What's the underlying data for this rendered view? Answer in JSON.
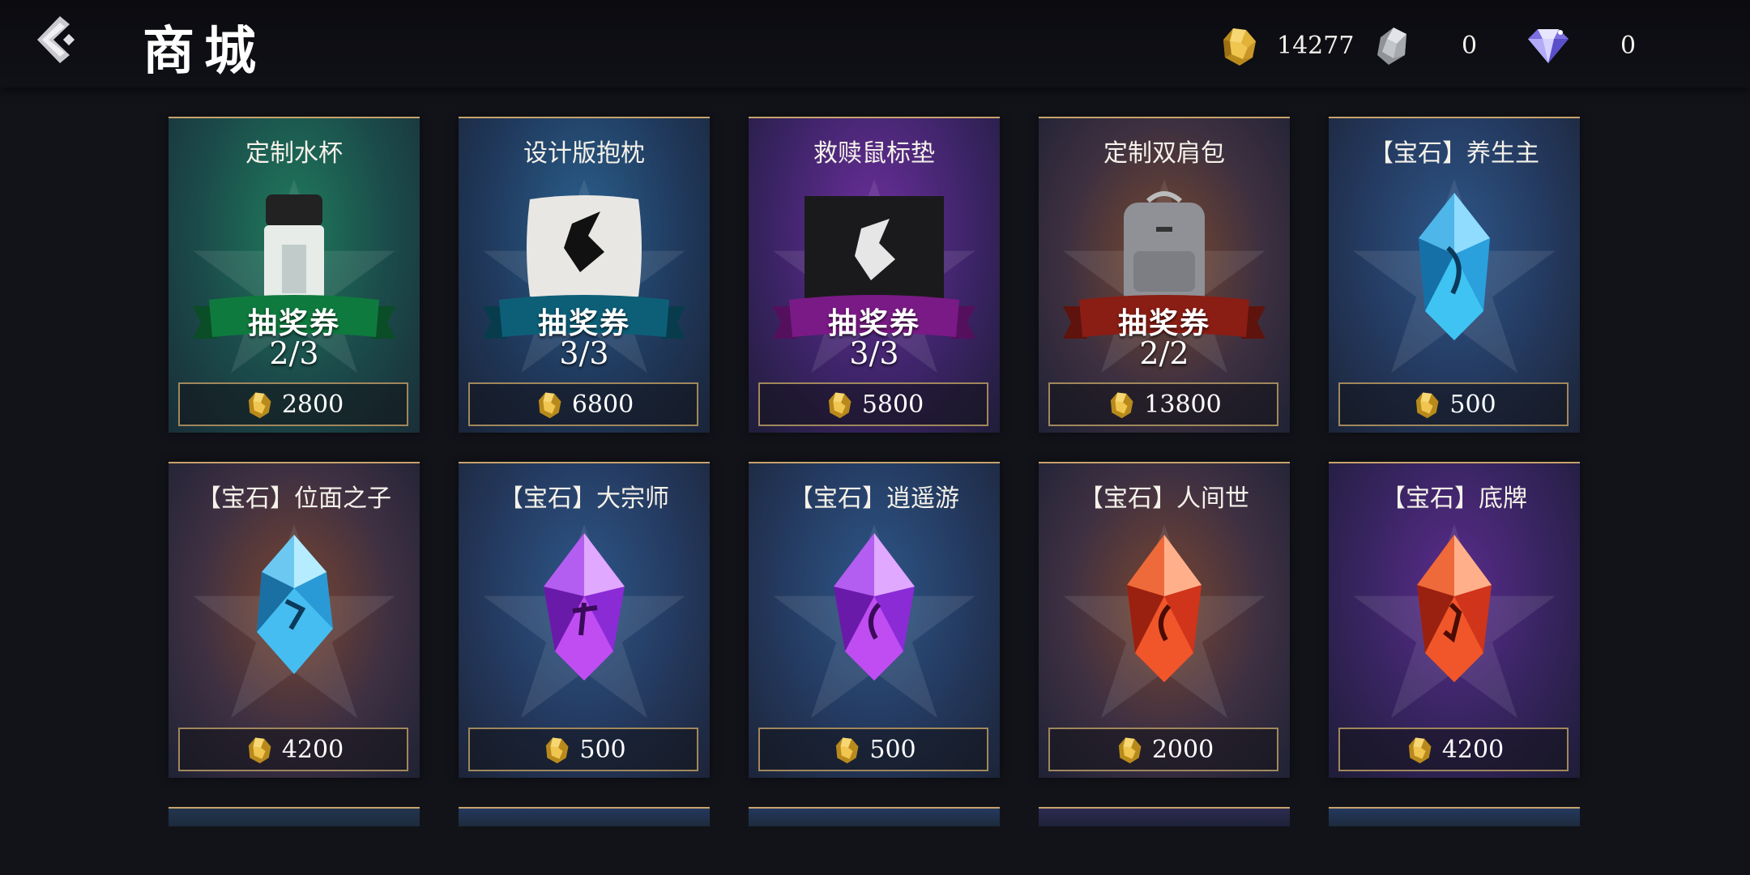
{
  "header": {
    "title": "商城",
    "currencies": [
      {
        "name": "gold",
        "value": "14277"
      },
      {
        "name": "silver",
        "value": "0"
      },
      {
        "name": "diamond",
        "value": "0"
      }
    ]
  },
  "items": [
    {
      "name": "定制水杯",
      "price": "2800",
      "ticket_label": "抽奖券",
      "ticket_count": "2/3",
      "theme": "green"
    },
    {
      "name": "设计版抱枕",
      "price": "6800",
      "ticket_label": "抽奖券",
      "ticket_count": "3/3",
      "theme": "blue"
    },
    {
      "name": "救赎鼠标垫",
      "price": "5800",
      "ticket_label": "抽奖券",
      "ticket_count": "3/3",
      "theme": "purple"
    },
    {
      "name": "定制双肩包",
      "price": "13800",
      "ticket_label": "抽奖券",
      "ticket_count": "2/2",
      "theme": "orange"
    },
    {
      "name": "【宝石】养生主",
      "price": "500",
      "theme": "navy"
    },
    {
      "name": "【宝石】位面之子",
      "price": "4200",
      "theme": "orange"
    },
    {
      "name": "【宝石】大宗师",
      "price": "500",
      "theme": "navy"
    },
    {
      "name": "【宝石】逍遥游",
      "price": "500",
      "theme": "navy"
    },
    {
      "name": "【宝石】人间世",
      "price": "2000",
      "theme": "orange"
    },
    {
      "name": "【宝石】底牌",
      "price": "4200",
      "theme": "purple"
    }
  ],
  "colors": {
    "accent_gold": "#c7a36b",
    "ribbon_green": "#0f7a3e",
    "ribbon_blue": "#0d5f78",
    "ribbon_purple": "#7a1a86",
    "ribbon_red": "#8a1d14"
  }
}
